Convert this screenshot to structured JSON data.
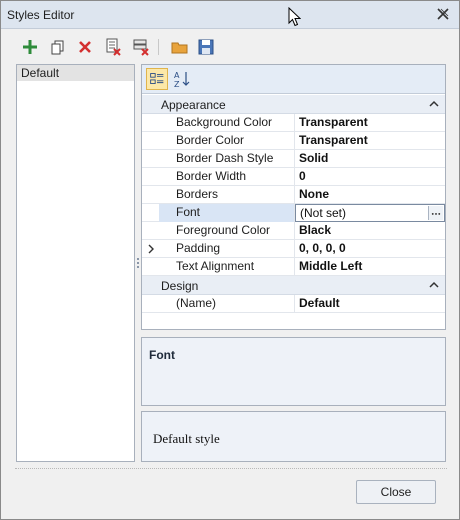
{
  "window": {
    "title": "Styles Editor"
  },
  "toolbar": {
    "icons": [
      "add-icon",
      "copy-icon",
      "delete-icon",
      "clear-icon",
      "purge-icon",
      "open-icon",
      "save-icon"
    ]
  },
  "style_list": {
    "items": [
      "Default"
    ]
  },
  "property_grid": {
    "categories": [
      {
        "label": "Appearance",
        "properties": [
          {
            "name": "Background Color",
            "value": "Transparent"
          },
          {
            "name": "Border Color",
            "value": "Transparent"
          },
          {
            "name": "Border Dash Style",
            "value": "Solid"
          },
          {
            "name": "Border Width",
            "value": "0"
          },
          {
            "name": "Borders",
            "value": "None"
          },
          {
            "name": "Font",
            "value": "(Not set)"
          },
          {
            "name": "Foreground Color",
            "value": "Black"
          },
          {
            "name": "Padding",
            "value": "0, 0, 0, 0"
          },
          {
            "name": "Text Alignment",
            "value": "Middle Left"
          }
        ]
      },
      {
        "label": "Design",
        "properties": [
          {
            "name": "(Name)",
            "value": "Default"
          }
        ]
      }
    ]
  },
  "description": {
    "title": "Font"
  },
  "help": {
    "text": "Default style"
  },
  "buttons": {
    "close": "Close"
  },
  "colors": {
    "accent": "#2e7d32",
    "danger": "#d32f2f",
    "selection": "#d9e5f5"
  }
}
